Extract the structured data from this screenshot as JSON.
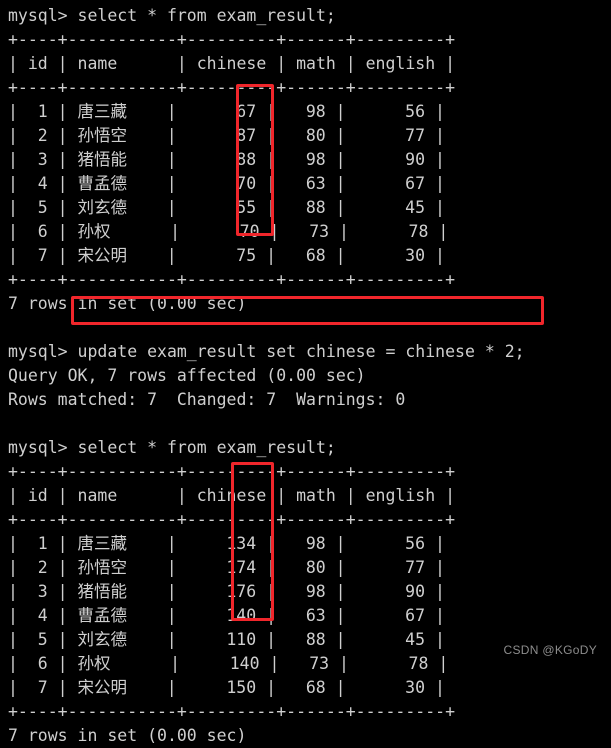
{
  "terminal": {
    "prompt": "mysql>",
    "colors": {
      "background": "#000000",
      "text": "#cfcfcf",
      "annotation": "#f0262b",
      "watermark": "#8d8d8d"
    },
    "watermark": "CSDN @KGoDY"
  },
  "table": {
    "separator": "+----+-----------+---------+------+---------+",
    "header_row": "| id | name      | chinese | math | english |",
    "columns": [
      "id",
      "name",
      "chinese",
      "math",
      "english"
    ]
  },
  "blocks": {
    "first_select": {
      "command_line": "mysql> select * from exam_result;",
      "command": "select * from exam_result;",
      "rows": [
        {
          "line": "|  1 | 唐三藏    |      67 |   98 |      56 |",
          "id": "1",
          "name": "唐三藏",
          "chinese": "67",
          "math": "98",
          "english": "56"
        },
        {
          "line": "|  2 | 孙悟空    |      87 |   80 |      77 |",
          "id": "2",
          "name": "孙悟空",
          "chinese": "87",
          "math": "80",
          "english": "77"
        },
        {
          "line": "|  3 | 猪悟能    |      88 |   98 |      90 |",
          "id": "3",
          "name": "猪悟能",
          "chinese": "88",
          "math": "98",
          "english": "90"
        },
        {
          "line": "|  4 | 曹孟德    |      70 |   63 |      67 |",
          "id": "4",
          "name": "曹孟德",
          "chinese": "70",
          "math": "63",
          "english": "67"
        },
        {
          "line": "|  5 | 刘玄德    |      55 |   88 |      45 |",
          "id": "5",
          "name": "刘玄德",
          "chinese": "55",
          "math": "88",
          "english": "45"
        },
        {
          "line": "|  6 | 孙权      |      70 |   73 |      78 |",
          "id": "6",
          "name": "孙权",
          "chinese": "70",
          "math": "73",
          "english": "78"
        },
        {
          "line": "|  7 | 宋公明    |      75 |   68 |      30 |",
          "id": "7",
          "name": "宋公明",
          "chinese": "75",
          "math": "68",
          "english": "30"
        }
      ],
      "footer": "7 rows in set (0.00 sec)"
    },
    "update": {
      "command_line": "mysql> update exam_result set chinese = chinese * 2;",
      "command": "update exam_result set chinese = chinese * 2;",
      "result_lines": [
        "Query OK, 7 rows affected (0.00 sec)",
        "Rows matched: 7  Changed: 7  Warnings: 0"
      ]
    },
    "second_select": {
      "command_line": "mysql> select * from exam_result;",
      "command": "select * from exam_result;",
      "rows": [
        {
          "line": "|  1 | 唐三藏    |     134 |   98 |      56 |",
          "id": "1",
          "name": "唐三藏",
          "chinese": "134",
          "math": "98",
          "english": "56"
        },
        {
          "line": "|  2 | 孙悟空    |     174 |   80 |      77 |",
          "id": "2",
          "name": "孙悟空",
          "chinese": "174",
          "math": "80",
          "english": "77"
        },
        {
          "line": "|  3 | 猪悟能    |     176 |   98 |      90 |",
          "id": "3",
          "name": "猪悟能",
          "chinese": "176",
          "math": "98",
          "english": "90"
        },
        {
          "line": "|  4 | 曹孟德    |     140 |   63 |      67 |",
          "id": "4",
          "name": "曹孟德",
          "chinese": "140",
          "math": "63",
          "english": "67"
        },
        {
          "line": "|  5 | 刘玄德    |     110 |   88 |      45 |",
          "id": "5",
          "name": "刘玄德",
          "chinese": "110",
          "math": "88",
          "english": "45"
        },
        {
          "line": "|  6 | 孙权      |     140 |   73 |      78 |",
          "id": "6",
          "name": "孙权",
          "chinese": "140",
          "math": "73",
          "english": "78"
        },
        {
          "line": "|  7 | 宋公明    |     150 |   68 |      30 |",
          "id": "7",
          "name": "宋公明",
          "chinese": "150",
          "math": "68",
          "english": "30"
        }
      ],
      "footer": "7 rows in set (0.00 sec)"
    }
  }
}
